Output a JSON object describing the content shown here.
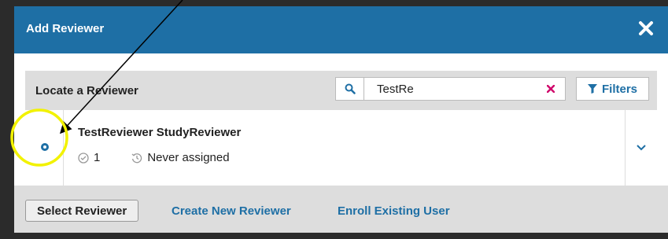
{
  "modal": {
    "title": "Add Reviewer"
  },
  "panel": {
    "title": "Locate a Reviewer",
    "search": {
      "value": "TestRe"
    },
    "filters_label": "Filters"
  },
  "reviewer": {
    "name": "TestReviewer StudyReviewer",
    "count": "1",
    "assigned": "Never assigned"
  },
  "footer": {
    "select_label": "Select Reviewer",
    "create_label": "Create New Reviewer",
    "enroll_label": "Enroll Existing User"
  },
  "colors": {
    "header_blue": "#1e6fa5",
    "clear_x_red": "#d00a6c",
    "annotation_yellow": "#f2f200"
  },
  "icons": [
    "close-icon",
    "search-icon",
    "clear-icon",
    "filter-icon",
    "check-circle-icon",
    "history-icon",
    "chevron-down-icon",
    "radio-icon"
  ]
}
